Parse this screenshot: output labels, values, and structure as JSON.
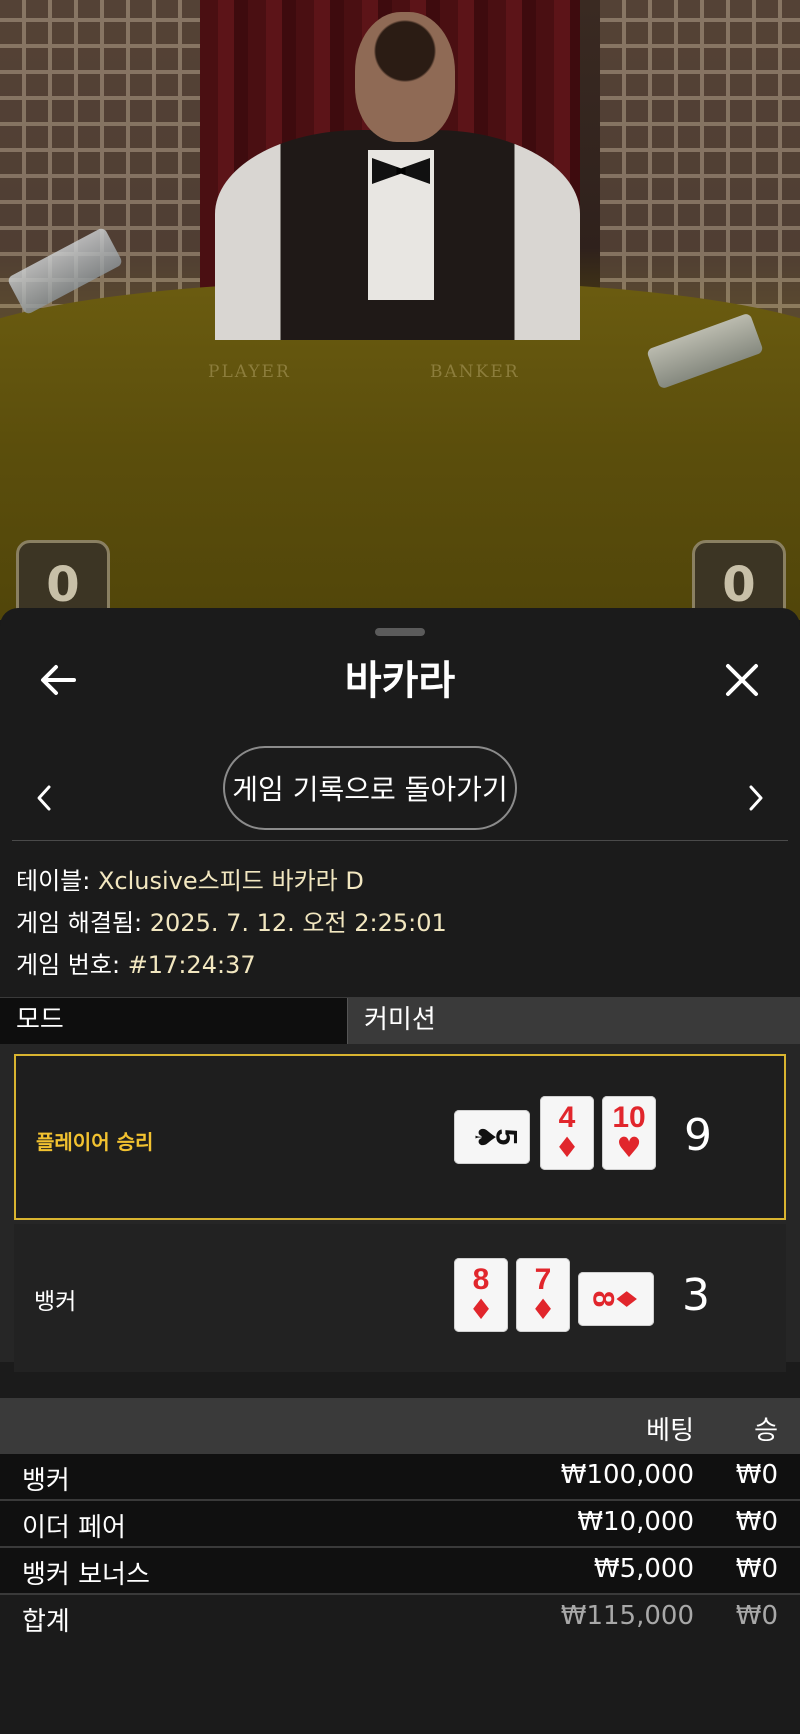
{
  "video": {
    "felt_labels": [
      "PLAYER",
      "BANKER"
    ],
    "player_score": "0",
    "banker_score": "0"
  },
  "header": {
    "title": "바카라",
    "back_icon": "arrow-left-icon",
    "close_icon": "close-icon"
  },
  "nav": {
    "back_to_history_label": "게임 기록으로 돌아가기",
    "prev_icon": "chevron-left-icon",
    "next_icon": "chevron-right-icon"
  },
  "info": {
    "table_label": "테이블:",
    "table_value": "Xclusive스피드 바카라 D",
    "resolved_label": "게임 해결됨:",
    "resolved_value": "2025. 7. 12. 오전 2:25:01",
    "game_no_label": "게임 번호:",
    "game_no_value": "#17:24:37"
  },
  "tabs": [
    {
      "label": "모드",
      "active": true
    },
    {
      "label": "커미션",
      "active": false
    }
  ],
  "results": {
    "player": {
      "label": "플레이어 승리",
      "score": "9",
      "cards": [
        {
          "rank": "5",
          "suit": "♠",
          "color": "black",
          "orientation": "sideways"
        },
        {
          "rank": "4",
          "suit": "♦",
          "color": "red",
          "orientation": "upright"
        },
        {
          "rank": "10",
          "suit": "♥",
          "color": "red",
          "orientation": "upright"
        }
      ]
    },
    "banker": {
      "label": "뱅커",
      "score": "3",
      "cards": [
        {
          "rank": "8",
          "suit": "♦",
          "color": "red",
          "orientation": "upright"
        },
        {
          "rank": "7",
          "suit": "♦",
          "color": "red",
          "orientation": "upright"
        },
        {
          "rank": "8",
          "suit": "♦",
          "color": "red",
          "orientation": "sideways"
        }
      ]
    }
  },
  "bets": {
    "col_bet": "베팅",
    "col_win": "승",
    "rows": [
      {
        "name": "뱅커",
        "bet": "₩100,000",
        "win": "₩0"
      },
      {
        "name": "이더 페어",
        "bet": "₩10,000",
        "win": "₩0"
      },
      {
        "name": "뱅커 보너스",
        "bet": "₩5,000",
        "win": "₩0"
      }
    ],
    "total": {
      "name": "합계",
      "bet": "₩115,000",
      "win": "₩0"
    }
  },
  "colors": {
    "winner_accent": "#d9b430",
    "info_value": "#f2e7c0",
    "card_red": "#e1262c"
  }
}
